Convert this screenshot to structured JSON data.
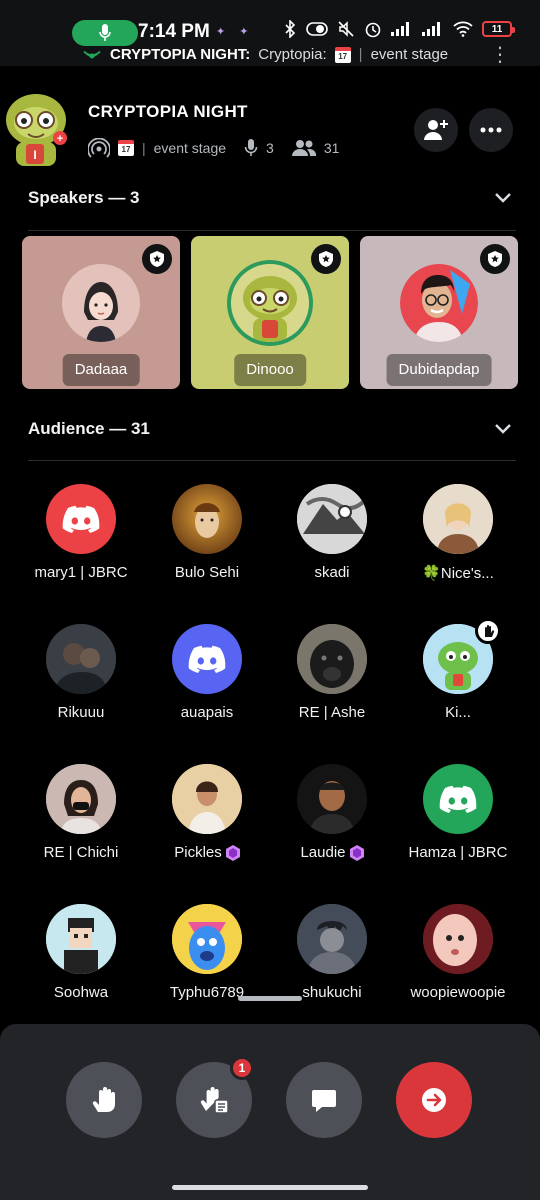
{
  "status_bar": {
    "time": "7:14 PM",
    "battery": "11",
    "ticker_title": "CRYPTOPIA NIGHT:",
    "ticker_text": "Cryptopia:",
    "ticker_stage": "event stage",
    "calendar_day": "17"
  },
  "stage": {
    "title": "CRYPTOPIA NIGHT",
    "calendar_day": "17",
    "stage_name": "event stage",
    "speaker_count": "3",
    "listener_count": "31"
  },
  "speakers": {
    "heading": "Speakers — 3",
    "items": [
      {
        "name": "Dadaaa",
        "bg": "#c49a92"
      },
      {
        "name": "Dinooo",
        "bg": "#c9cd72"
      },
      {
        "name": "Dubidapdap",
        "bg": "#c7b9bb"
      }
    ]
  },
  "audience": {
    "heading": "Audience — 31",
    "members": [
      {
        "name": "mary1 | JBRC",
        "avatar": "discord-red"
      },
      {
        "name": "Bulo Sehi",
        "avatar": "photo-gold"
      },
      {
        "name": "skadi",
        "avatar": "photo-gray"
      },
      {
        "name": "🍀Nice's...",
        "avatar": "photo-beige"
      },
      {
        "name": "Rikuuu",
        "avatar": "photo-dark"
      },
      {
        "name": "auapais",
        "avatar": "discord-blurple"
      },
      {
        "name": "RE | Ashe",
        "avatar": "photo-dog"
      },
      {
        "name": "Ki...",
        "avatar": "dino-blue"
      },
      {
        "name": "RE | Chichi",
        "avatar": "photo-girl"
      },
      {
        "name": "Pickles",
        "avatar": "photo-warm"
      },
      {
        "name": "Laudie",
        "avatar": "photo-man"
      },
      {
        "name": "Hamza | JBRC",
        "avatar": "discord-green"
      },
      {
        "name": "Soohwa",
        "avatar": "pixel-boy"
      },
      {
        "name": "Typhu6789",
        "avatar": "cartoon-blue"
      },
      {
        "name": "shukuchi",
        "avatar": "anime-dark"
      },
      {
        "name": "woopiewoopie",
        "avatar": "photo-pink"
      }
    ]
  },
  "controls": {
    "raise_hand_label": "Raise hand",
    "hand_queue_count": "1"
  },
  "colors": {
    "discord_red": "#ed4245",
    "discord_blurple": "#5865f2",
    "discord_green": "#23a55a",
    "nitro_purple": "#d084f5"
  }
}
